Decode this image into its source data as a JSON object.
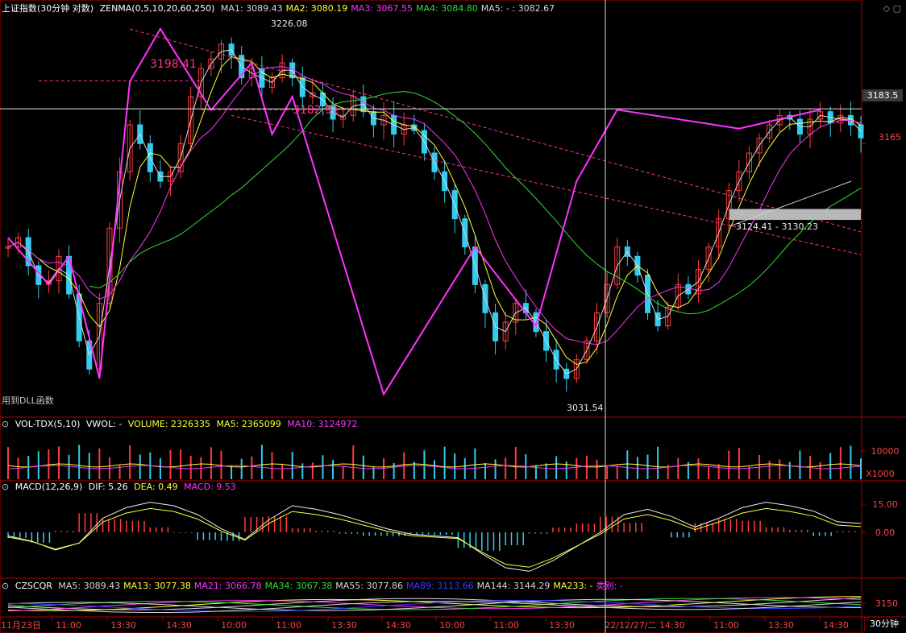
{
  "main_panel": {
    "index_name": "上证指数",
    "period_note": "(30分钟 对数)",
    "indicator": "ZENMA(0,5,10,20,60,250)",
    "ma_items": [
      {
        "label": "MA1: 3089.43",
        "color": "#d8d8d8"
      },
      {
        "label": "MA2: 3080.19",
        "color": "#ffff33"
      },
      {
        "label": "MA3: 3067.55",
        "color": "#ff33ff"
      },
      {
        "label": "MA4: 3084.80",
        "color": "#33dd33"
      },
      {
        "label": "MA5: - : 3082.67",
        "color": "#d8d8d8"
      }
    ],
    "corner_icons": "◇ ▢",
    "dll_note": "用到DLL函数",
    "annotations": {
      "high_3226": "3226.08",
      "level_3198": "3198.41",
      "level_3182": "3182.91",
      "low_3031": "3031.54",
      "gap_zone": "3124.41 - 3130.23"
    },
    "crosshair_price": "3183.5",
    "tick_3165": "3165"
  },
  "vol_panel": {
    "title": "VOL-TDX(5,10)",
    "vwol": "VWOL: -",
    "volume": "VOLUME: 2326335",
    "ma5": "MA5: 2365099",
    "ma10": "MA10: 3124972",
    "tick": "10000",
    "unit": "X1000"
  },
  "macd_panel": {
    "title": "MACD(12,26,9)",
    "dif": "DIF: 5.26",
    "dea": "DEA: 0.49",
    "macd": "MACD: 9.53",
    "ticks": [
      "15.00",
      "0.00"
    ]
  },
  "czs_panel": {
    "title": "CZSCQR",
    "items": [
      {
        "label": "MA5: 3089.43",
        "color": "#d8d8d8"
      },
      {
        "label": "MA13: 3077.38",
        "color": "#ffff33"
      },
      {
        "label": "MA21: 3066.78",
        "color": "#ff33ff"
      },
      {
        "label": "MA34: 3067.38",
        "color": "#33dd33"
      },
      {
        "label": "MA55: 3077.86",
        "color": "#d8d8d8"
      },
      {
        "label": "MA89: 3113.66",
        "color": "#3a3aff"
      },
      {
        "label": "MA144: 3144.29",
        "color": "#d8d8d8"
      },
      {
        "label": "MA233: -",
        "color": "#ffff33"
      },
      {
        "label": "类别: -",
        "color": "#ff33ff"
      }
    ],
    "tick": "3150"
  },
  "time_axis": {
    "labels": [
      "11月23日",
      "11:00",
      "13:30",
      "14:30",
      "10:00",
      "11:00",
      "13:30",
      "14:30",
      "10:00",
      "11:00",
      "13:30",
      "22/12/27/二 14:30",
      "11:00",
      "13:30",
      "14:30"
    ],
    "period": "30分钟"
  },
  "colors": {
    "up": "#ff3c3c",
    "down": "#33ccee",
    "ma_white": "#d8d8d8",
    "ma_yellow": "#ffff33",
    "ma_magenta": "#ff33ff",
    "ma_green": "#33dd33",
    "axis": "#b00000"
  },
  "chart_data": {
    "type": "candlestick",
    "title": "上证指数 (30分钟 对数)",
    "xlabel": "",
    "ylabel": "",
    "price_range_visible": [
      3025,
      3232
    ],
    "marked_high": 3226.08,
    "marked_low": 3031.54,
    "levels": [
      3198.41,
      3182.91,
      3183.5,
      3165
    ],
    "gap_zone": [
      3124.41,
      3130.23
    ],
    "zigzag_points": [
      3115,
      3090,
      3105,
      3040,
      3198,
      3226.08,
      3182.9,
      3208,
      3170,
      3190,
      3031.54,
      3110,
      3068,
      3145,
      3183,
      3173,
      3183
    ],
    "close_path": [
      3110,
      3115,
      3100,
      3090,
      3092,
      3105,
      3085,
      3060,
      3045,
      3080,
      3120,
      3150,
      3175,
      3165,
      3150,
      3145,
      3150,
      3165,
      3190,
      3205,
      3210,
      3218,
      3212,
      3200,
      3205,
      3195,
      3200,
      3208,
      3200,
      3190,
      3192,
      3185,
      3178,
      3180,
      3190,
      3182,
      3175,
      3180,
      3170,
      3175,
      3172,
      3160,
      3150,
      3140,
      3125,
      3110,
      3090,
      3075,
      3060,
      3070,
      3080,
      3075,
      3065,
      3055,
      3045,
      3040,
      3050,
      3060,
      3075,
      3090,
      3110,
      3105,
      3095,
      3075,
      3068,
      3078,
      3090,
      3085,
      3098,
      3110,
      3125,
      3140,
      3150,
      3160,
      3168,
      3175,
      3180,
      3178,
      3170,
      3178,
      3182,
      3176,
      3180,
      3175,
      3168
    ],
    "volume_ma5": 2365099,
    "volume_ma10": 3124972,
    "volume_last": 2326335,
    "macd": {
      "dif": 5.26,
      "dea": 0.49,
      "macd": 9.53,
      "dif_path": [
        -2,
        -5,
        -10,
        -6,
        8,
        14,
        17,
        15,
        10,
        2,
        -4,
        7,
        15,
        13,
        10,
        6,
        2,
        -1,
        -2,
        -3,
        -12,
        -20,
        -22,
        -16,
        -8,
        0,
        10,
        13,
        9,
        3,
        8,
        14,
        17,
        15,
        12,
        6,
        5
      ]
    },
    "czs": {
      "ma5": 3089.43,
      "ma13": 3077.38,
      "ma21": 3066.78,
      "ma34": 3067.38,
      "ma55": 3077.86,
      "ma89": 3113.66,
      "ma144": 3144.29
    }
  }
}
